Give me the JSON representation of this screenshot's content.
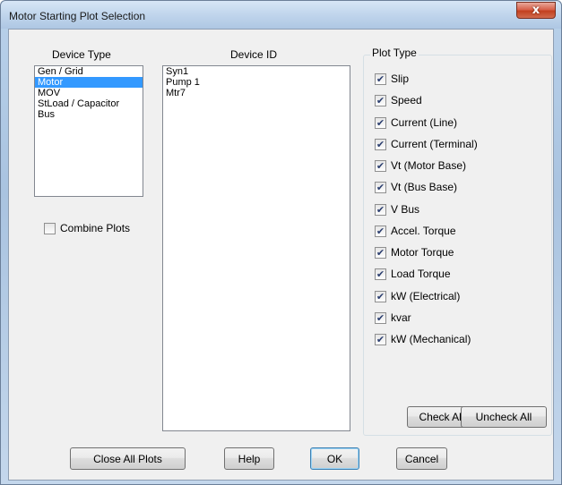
{
  "window": {
    "title": "Motor Starting Plot Selection",
    "close_glyph": "x"
  },
  "device_type": {
    "label": "Device Type",
    "items": [
      "Gen / Grid",
      "Motor",
      "MOV",
      "StLoad / Capacitor",
      "Bus"
    ],
    "selected_index": 1
  },
  "device_id": {
    "label": "Device ID",
    "items": [
      "Syn1",
      "Pump 1",
      "Mtr7"
    ]
  },
  "combine_plots": {
    "label": "Combine Plots",
    "checked": false
  },
  "plot_type": {
    "legend": "Plot Type",
    "options": [
      {
        "label": "Slip",
        "checked": true
      },
      {
        "label": "Speed",
        "checked": true
      },
      {
        "label": "Current (Line)",
        "checked": true
      },
      {
        "label": "Current (Terminal)",
        "checked": true
      },
      {
        "label": "Vt (Motor Base)",
        "checked": true
      },
      {
        "label": "Vt (Bus Base)",
        "checked": true
      },
      {
        "label": "V Bus",
        "checked": true
      },
      {
        "label": "Accel. Torque",
        "checked": true
      },
      {
        "label": "Motor Torque",
        "checked": true
      },
      {
        "label": "Load Torque",
        "checked": true
      },
      {
        "label": "kW (Electrical)",
        "checked": true
      },
      {
        "label": "kvar",
        "checked": true
      },
      {
        "label": "kW (Mechanical)",
        "checked": true
      }
    ],
    "check_all_label": "Check All",
    "uncheck_all_label": "Uncheck All"
  },
  "buttons": {
    "close_all_plots": "Close All Plots",
    "help": "Help",
    "ok": "OK",
    "cancel": "Cancel"
  },
  "checkmark_glyph": "✔"
}
